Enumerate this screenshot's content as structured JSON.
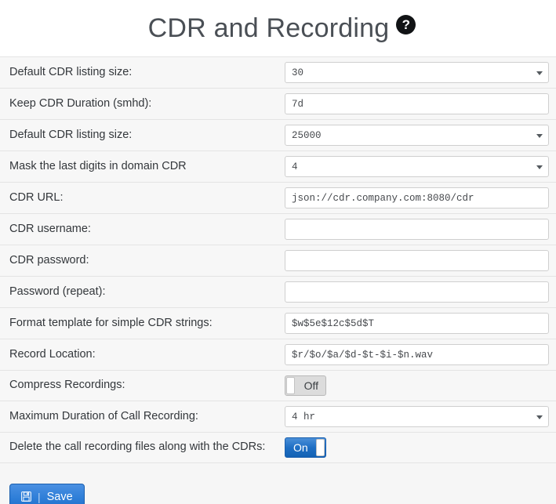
{
  "header": {
    "title": "CDR and Recording",
    "help_icon": "help-circle-icon",
    "help_glyph": "?"
  },
  "form": {
    "rows": [
      {
        "label": "Default CDR listing size:",
        "type": "select",
        "value": "30"
      },
      {
        "label": "Keep CDR Duration (smhd):",
        "type": "text",
        "value": "7d"
      },
      {
        "label": "Default CDR listing size:",
        "type": "select",
        "value": "25000"
      },
      {
        "label": "Mask the last digits in domain CDR",
        "type": "select",
        "value": "4"
      },
      {
        "label": "CDR URL:",
        "type": "text",
        "value": "json://cdr.company.com:8080/cdr"
      },
      {
        "label": "CDR username:",
        "type": "text",
        "value": ""
      },
      {
        "label": "CDR password:",
        "type": "text",
        "value": ""
      },
      {
        "label": "Password (repeat):",
        "type": "text",
        "value": ""
      },
      {
        "label": "Format template for simple CDR strings:",
        "type": "text",
        "value": "$w$5e$12c$5d$T"
      },
      {
        "label": "Record Location:",
        "type": "text",
        "value": "$r/$o/$a/$d-$t-$i-$n.wav"
      },
      {
        "label": "Compress Recordings:",
        "type": "toggle",
        "value": "Off",
        "state": "off"
      },
      {
        "label": "Maximum Duration of Call Recording:",
        "type": "select",
        "value": "4 hr"
      },
      {
        "label": "Delete the call recording files along with the CDRs:",
        "type": "toggle",
        "value": "On",
        "state": "on"
      }
    ]
  },
  "footer": {
    "save_label": "Save",
    "save_icon": "floppy-disk-icon",
    "save_glyph": "💾",
    "divider": "|"
  },
  "colors": {
    "accent": "#2f7fd8",
    "toggle_on": "#1f6fc4",
    "toggle_off": "#dcdcdc",
    "page_bg": "#f6f6f6",
    "row_bg": "#f7f7f7",
    "text": "#33373b"
  }
}
